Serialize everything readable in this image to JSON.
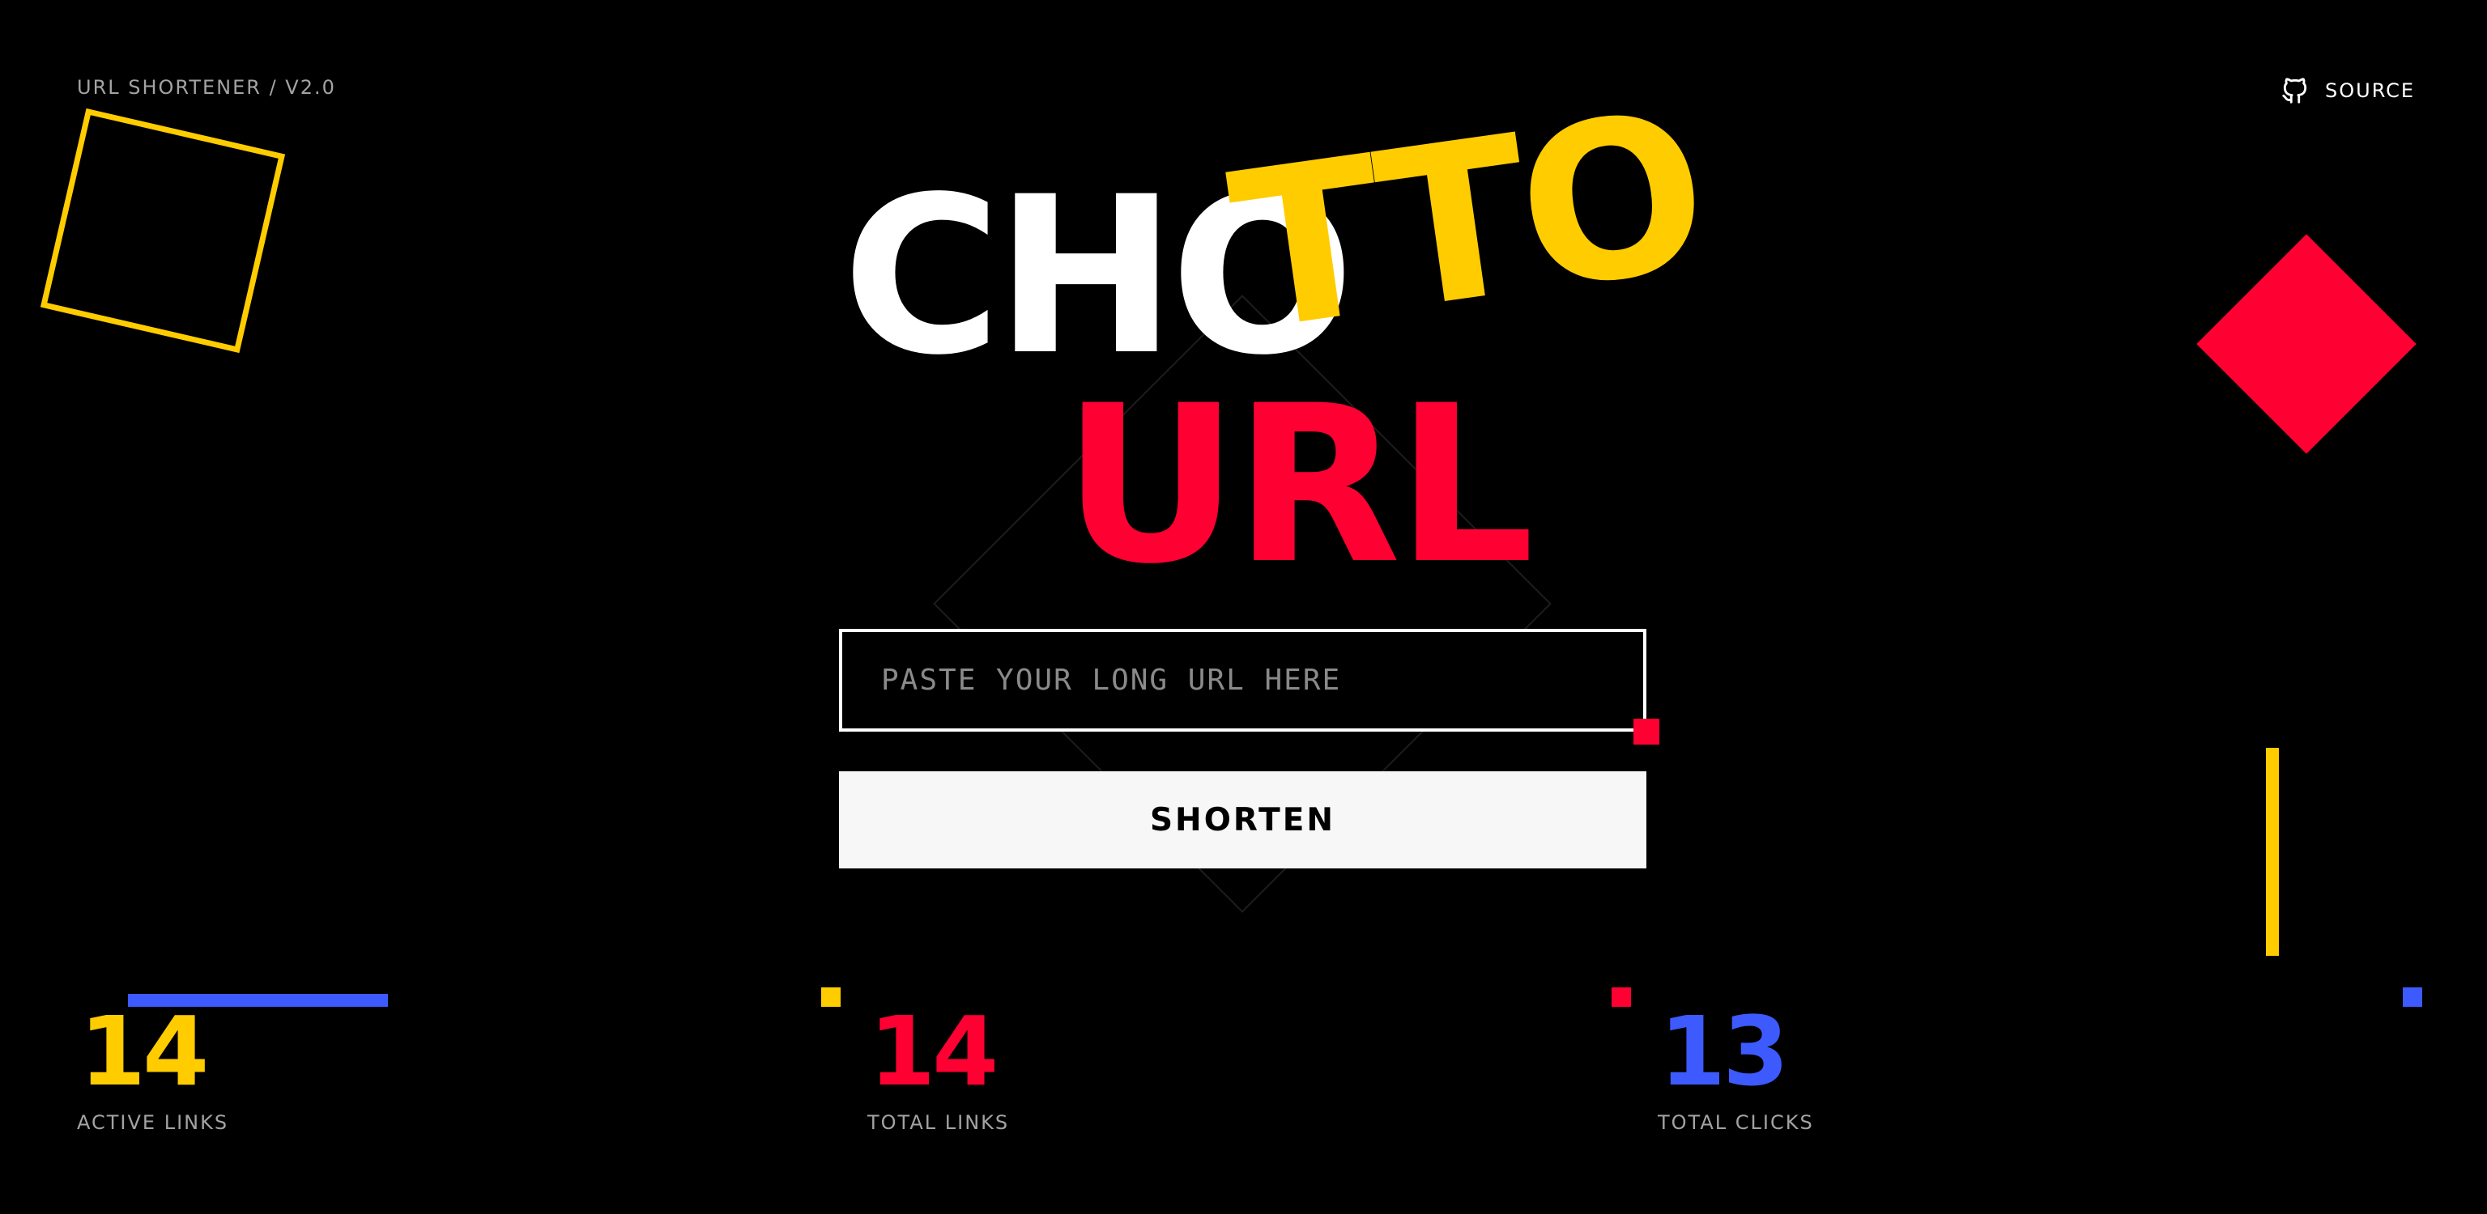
{
  "header": {
    "brand_tag": "URL SHORTENER / V2.0",
    "source_label": "SOURCE",
    "source_icon": "github-icon"
  },
  "logo": {
    "part1": "CHO",
    "part2": "TTO",
    "part3": "URL"
  },
  "form": {
    "url_placeholder": "PASTE YOUR LONG URL HERE",
    "url_value": "",
    "submit_label": "SHORTEN"
  },
  "stats": [
    {
      "value": "14",
      "label": "ACTIVE LINKS",
      "color": "#ffcc00"
    },
    {
      "value": "14",
      "label": "TOTAL LINKS",
      "color": "#ff0033"
    },
    {
      "value": "13",
      "label": "TOTAL CLICKS",
      "color": "#3d5afe"
    }
  ],
  "colors": {
    "background": "#000000",
    "yellow": "#ffcc00",
    "red": "#ff0033",
    "blue": "#3d5afe",
    "white": "#ffffff",
    "muted": "#a3a3a3"
  }
}
